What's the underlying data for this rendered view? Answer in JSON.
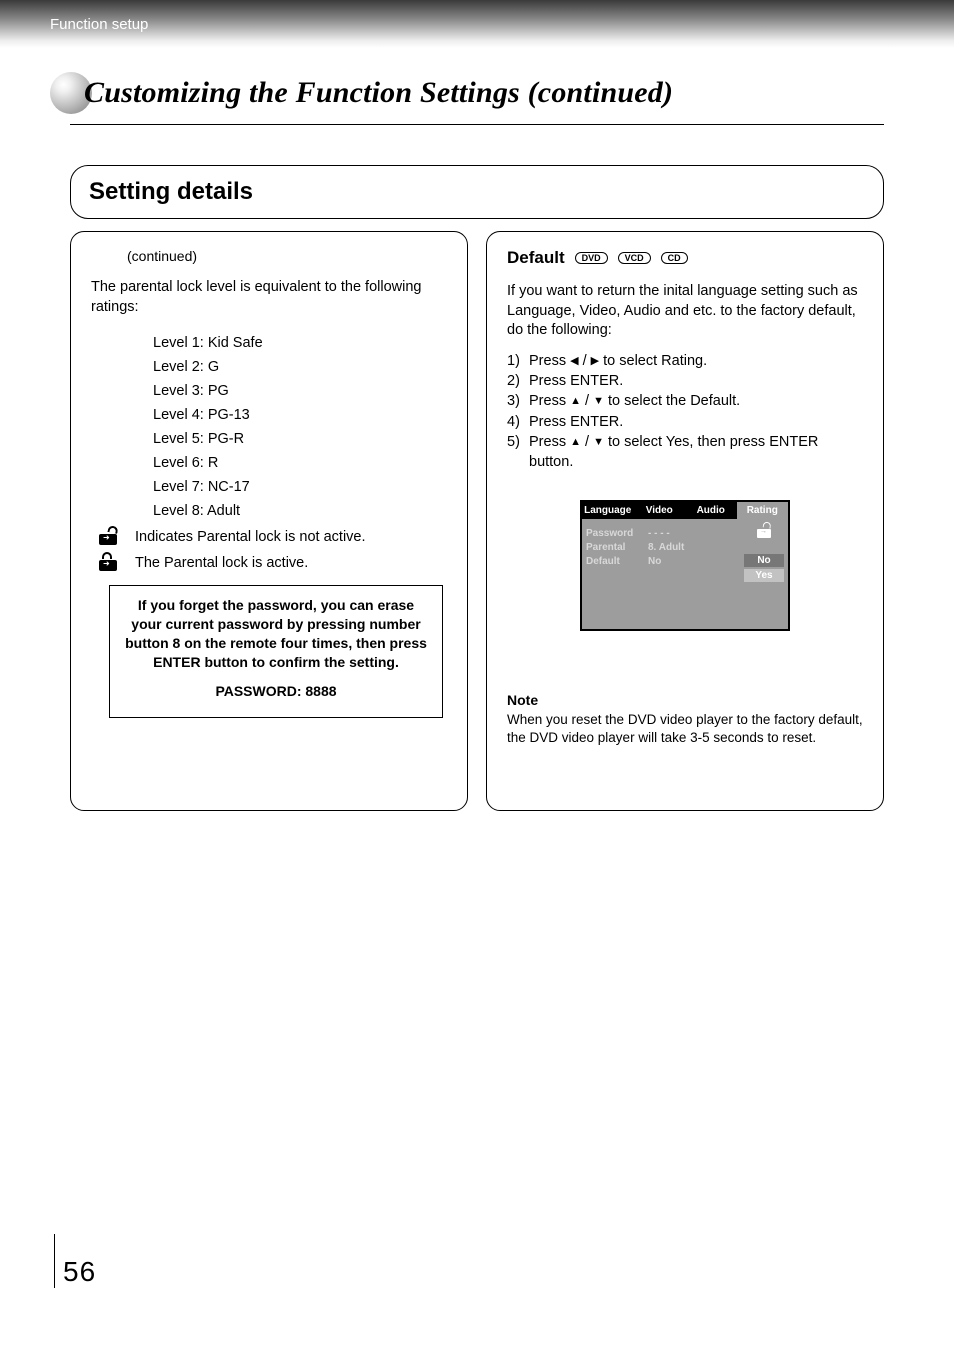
{
  "breadcrumb": "Function setup",
  "title": "Customizing the Function Settings (continued)",
  "section_header": "Setting details",
  "left": {
    "continued": "(continued)",
    "intro": "The parental lock level is equivalent to the following ratings:",
    "levels": [
      "Level 1: Kid Safe",
      "Level 2: G",
      "Level 3: PG",
      "Level 4: PG-13",
      "Level 5: PG-R",
      "Level 6: R",
      "Level 7: NC-17",
      "Level 8: Adult"
    ],
    "lock_open_text": "Indicates Parental lock is not active.",
    "lock_closed_text": "The Parental lock is active.",
    "forgot_line1": "If you forget the password, you can erase",
    "forgot_line2": "your current password by pressing number",
    "forgot_line3": "button 8 on the remote four times, then press",
    "forgot_line4": "ENTER button to confirm the setting.",
    "password_line": "PASSWORD: 8888"
  },
  "right": {
    "heading": "Default",
    "badges": [
      "DVD",
      "VCD",
      "CD"
    ],
    "intro": "If you want to return the inital language setting such as Language, Video, Audio and etc. to the factory default, do the following:",
    "steps_num": [
      "1)",
      "2)",
      "3)",
      "4)",
      "5)"
    ],
    "step1_a": "Press ",
    "step1_b": " / ",
    "step1_c": " to select Rating.",
    "step2": "Press ENTER.",
    "step3_a": "Press ",
    "step3_b": " / ",
    "step3_c": " to select the Default.",
    "step4": "Press ENTER.",
    "step5_a": "Press ",
    "step5_b": " / ",
    "step5_c": " to select Yes, then press ENTER button.",
    "osd": {
      "tabs": [
        "Language",
        "Video",
        "Audio",
        "Rating"
      ],
      "active_tab_index": 3,
      "left_items": [
        "Password",
        "Parental",
        "Default"
      ],
      "mid_items": [
        "- - - -",
        "8. Adult",
        "No"
      ],
      "options": [
        "No",
        "Yes"
      ],
      "selected_option_index": 1
    },
    "note_head": "Note",
    "note_body": "When you reset the DVD video player to the factory default, the DVD video player will take 3-5 seconds to reset."
  },
  "page_number": "56"
}
